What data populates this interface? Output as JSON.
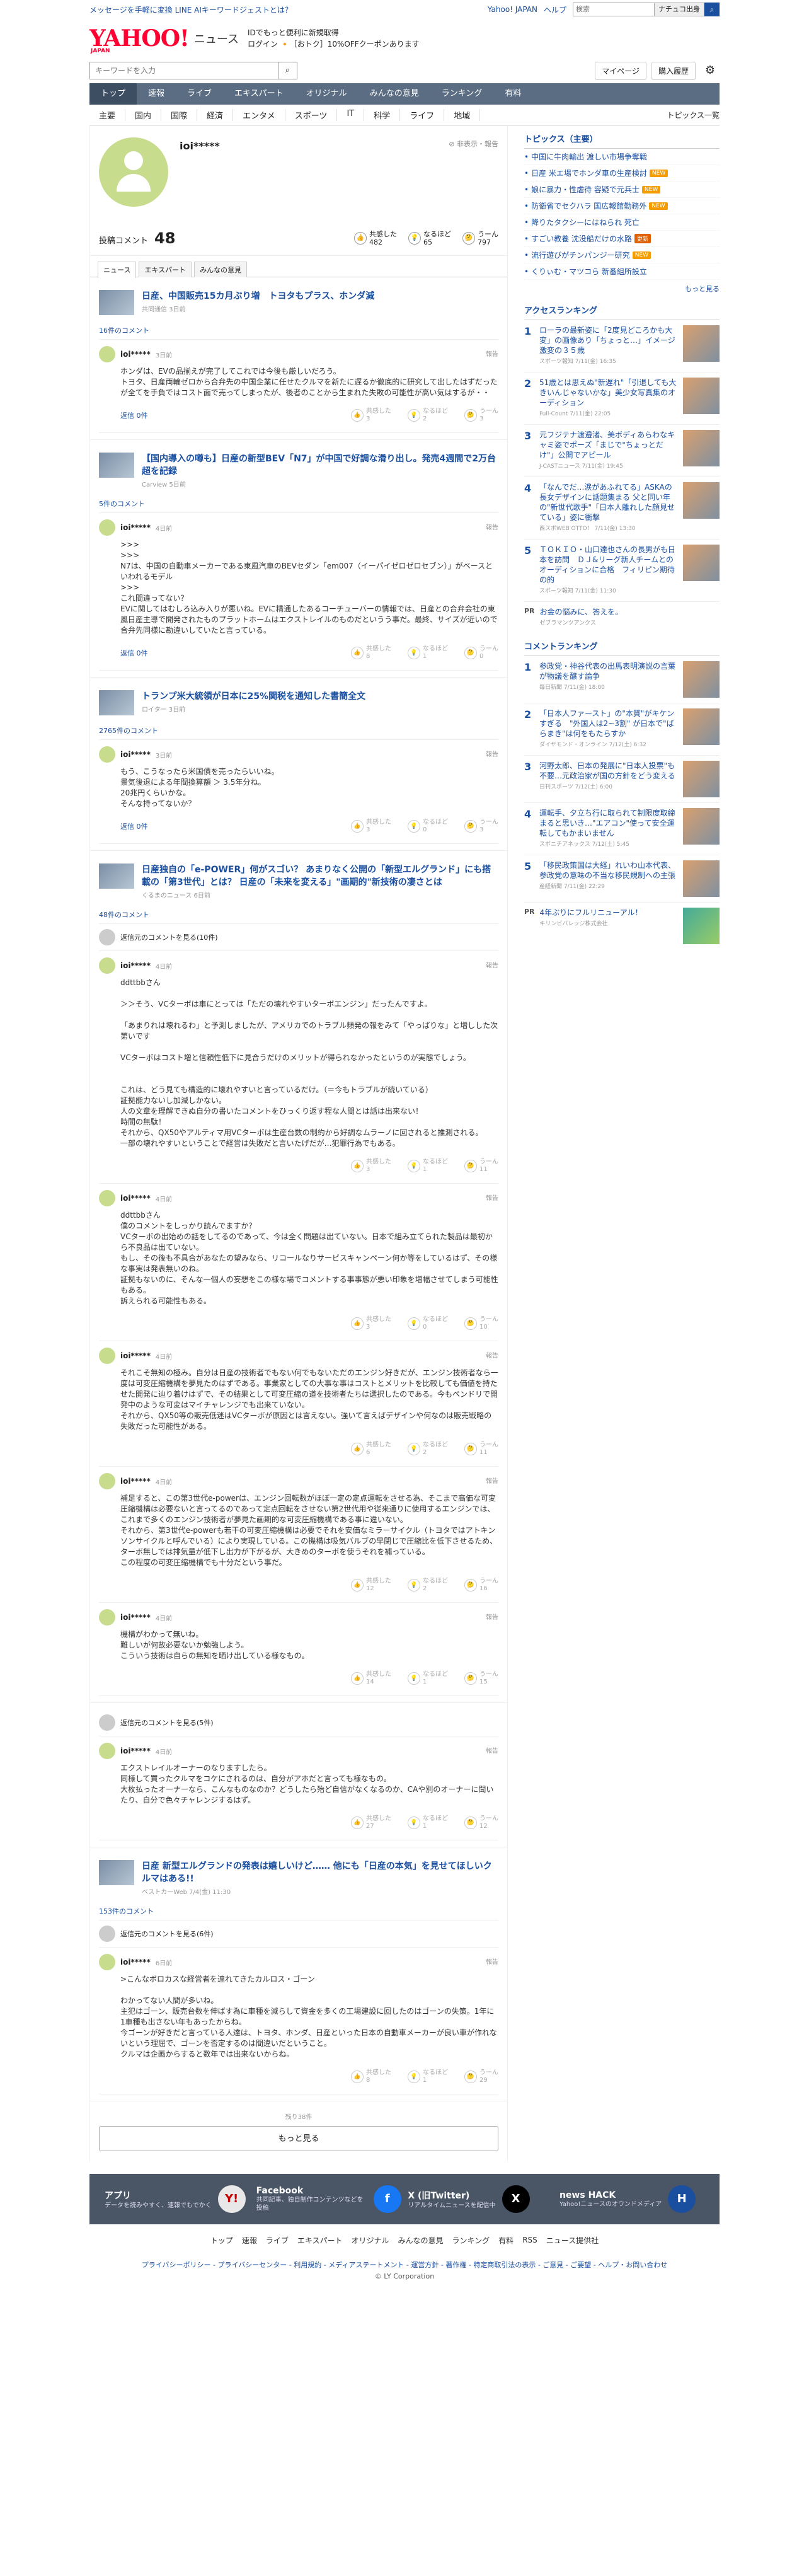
{
  "topbar": {
    "promo": "メッセージを手軽に変換 LINE AIキーワードジェストとは？",
    "yahoo_link": "Yahoo! JAPAN",
    "help": "ヘルプ",
    "search_placeholder": "検索",
    "search_button": "ナチュコ出身",
    "search_icon": "search-icon"
  },
  "header": {
    "logo": "YAHOO!",
    "logo_sub": "JAPAN",
    "logo_news": "ニュース",
    "promo_line1": "IDでもっと便利に新規取得",
    "promo_line2": "ログイン 🔸［おトク］10%OFFクーポンあります"
  },
  "searchrow": {
    "placeholder": "キーワードを入力",
    "mypage": "マイページ",
    "shopping": "購入履歴"
  },
  "nav1": [
    "トップ",
    "速報",
    "ライブ",
    "エキスパート",
    "オリジナル",
    "みんなの意見",
    "ランキング",
    "有料"
  ],
  "nav2": {
    "items": [
      "主要",
      "国内",
      "国際",
      "経済",
      "エンタメ",
      "スポーツ",
      "IT",
      "科学",
      "ライフ",
      "地域"
    ],
    "right": "トピックス一覧"
  },
  "profile": {
    "name": "ioi*****",
    "caution": "⊘ 非表示・報告"
  },
  "stats": {
    "label": "投稿コメント",
    "count": "48",
    "r1_label": "共感した",
    "r1": "482",
    "r2_label": "なるほど",
    "r2": "65",
    "r3_label": "うーん",
    "r3": "797"
  },
  "tabs": [
    "ニュース",
    "エキスパート",
    "みんなの意見"
  ],
  "blocks": [
    {
      "title": "日産、中国販売15カ月ぶり増　トヨタもプラス、ホンダ減",
      "meta": "共同通信 3日前",
      "count": "16件のコメント",
      "hidden": "",
      "comments": [
        {
          "name": "ioi*****",
          "date": "3日前",
          "body": "ホンダは、EVの品揃えが完了してこれでは今後も厳しいだろう。\nトヨタ、日産両輪ゼロから合弁先の中国企業に任せたクルマを新たに遅るか徹底的に研究して出したはずだったが全てを手負ではコスト面で売ってしまったが、後者のことから生まれた失敗の可能性が高い気はするが・・",
          "reply": "返信 0件",
          "a": "3",
          "b": "2",
          "c": "3"
        }
      ]
    },
    {
      "title": "【国内導入の噂も】日産の新型BEV「N7」が中国で好調な滑り出し。発売4週間で2万台超を記録",
      "meta": "Carview 5日前",
      "count": "5件のコメント",
      "hidden": "",
      "comments": [
        {
          "name": "ioi*****",
          "date": "4日前",
          "body": ">>>\n>>>\nN7は、中国の自動車メーカーである東風汽車のBEVセダン「em007（イーパイゼロゼロセブン）」がベースといわれるモデル\n>>>\nこれ間違ってない？\nEVに関してはむしろ込み入りが悪いね。EVに精通したあるコーチューバーの情報では、日産との合弁会社の東風日産主導で開発されたものプラットホームはエクストレイルのものだというう事だ。最終、サイズが近いので合弁先同様に勘違いしていたと言っている。",
          "reply": "返信 0件",
          "a": "8",
          "b": "1",
          "c": "0"
        }
      ]
    },
    {
      "title": "トランプ米大統領が日本に25%関税を通知した書簡全文",
      "meta": "ロイター 3日前",
      "count": "2765件のコメント",
      "hidden": "",
      "comments": [
        {
          "name": "ioi*****",
          "date": "3日前",
          "body": "もう、こうなったら米国債を売ったらいいね。\n景気後退による年間換算額 ＞ 3.5年分ね。\n20兆円くらいかな。\nそんな持ってないか？",
          "reply": "返信 0件",
          "a": "3",
          "b": "0",
          "c": "3"
        }
      ]
    },
    {
      "title": "日産独自の「e-POWER」何がスゴい？ あまりなく公開の「新型エルグランド」にも搭載の「第3世代」とは？ 日産の「未来を変える」\"画期的\"新技術の凄さとは",
      "meta": "くるまのニュース 6日前",
      "count": "48件のコメント",
      "hidden": "返信元のコメントを見る(10件)",
      "comments": [
        {
          "name": "ioi*****",
          "date": "4日前",
          "body": "ddttbbさん\n\n＞＞そう、VCターボは車にとっては「ただの壊れやすいターボエンジン」だったんですよ。\n\n「あまりれは壊れるわ」と予測しましたが、アメリカでのトラブル頻発の報をみて「やっぱりな」と増しした次第いです\n\nVCターボはコスト増と信頼性低下に見合うだけのメリットが得られなかったというのが実態でしょう。\n\n\nこれは、どう見ても構造的に壊れやすいと言っているだけ。（＝今もトラブルが続いている）\n証拠能力ないし加減しかない。\n人の文章を理解できぬ自分の書いたコメントをひっくり返す程な人間とは話は出来ない！\n時間の無駄！\nそれから、QX50やアルティマ用VCターボは生産台数の制約から好調なムラーノに回されると推測される。\n一部の壊れやすいということで経営は失敗だと言いたげだが…犯罪行為でもある。",
          "reply": "",
          "a": "3",
          "b": "1",
          "c": "11"
        },
        {
          "name": "ioi*****",
          "date": "4日前",
          "body": "ddttbbさん\n僕のコメントをしっかり読んでますか？\nVCターボの出始めの話をしてるのであって、今は全く問題は出ていない。日本で組み立てられた製品は最初から不良品は出ていない。\nもし、その後も不具合があなたの望みなら、リコールなりサービスキャンペーン何か等をしているはず、その様な事実は発表無いのね。\n証拠もないのに、そんな一個人の妄想をこの様な場でコメントする事事態が悪い印象を増幅させてしまう可能性もある。\n訴えられる可能性もある。",
          "reply": "",
          "a": "3",
          "b": "0",
          "c": "10"
        },
        {
          "name": "ioi*****",
          "date": "4日前",
          "body": "それこそ無知の極み。自分は日産の技術者でもない何でもないただのエンジン好きだが、エンジン技術者なら一度は可変圧縮機構を夢見たのはずである。事業家としての大事な事はコストとメリットを比較しても価値を持たせた開発に辿り着けはずで、その結果として可変圧縮の道を技術者たちは選択したのである。今もペンドリで開発中のような可変はマイチャレンジでも出来ていない。\nそれから、QX50等の販売低迷はVCターボが原因とは言えない。強いて言えばデザインや何なのは販売戦略の失敗だった可能性がある。",
          "reply": "",
          "a": "6",
          "b": "2",
          "c": "11"
        },
        {
          "name": "ioi*****",
          "date": "4日前",
          "body": "補足すると、この第3世代e-powerは、エンジン回転数がほぼ一定の定点運転をさせる為、そこまで高価な可変圧縮機構は必要ないと言ってるのであって定点回転をさせない第2世代用や従来通りに使用するエンジンでは、これまで多くのエンジン技術者が夢見た画期的な可変圧縮機構である事に違いない。\nそれから、第3世代e-powerも若干の可変圧縮機構は必要でそれを安価なミラーサイクル（トヨタではアトキンソンサイクルと呼んでいる）により実現している。この機構は吸気バルブの早閉じで圧縮比を低下させるため、ターボ無しでは排気量が低下し出力が下がるが、大きめのターボを使うそれを補っている。\nこの程度の可変圧縮機構でも十分だという事だ。",
          "reply": "",
          "a": "12",
          "b": "2",
          "c": "16"
        },
        {
          "name": "ioi*****",
          "date": "4日前",
          "body": "機構がわかって無いね。\n難しいが何故必要ないか勉強しよう。\nこういう技術は自らの無知を晒け出している様なもの。",
          "reply": "",
          "a": "14",
          "b": "1",
          "c": "15"
        }
      ]
    },
    {
      "title": "",
      "meta": "",
      "count": "",
      "hidden": "返信元のコメントを見る(5件)",
      "comments": [
        {
          "name": "ioi*****",
          "date": "4日前",
          "body": "エクストレイルオーナーのなりますしたら。\n同様して買ったクルマをコケにされるのは、自分がアホだと言っても様なもの。\n大枚払ったオーナーなら、こんなものなのか？どうしたら殆ど自信がなくなるのか、CAや別のオーナーに聞いたり、自分で色々チャレンジするはず。",
          "reply": "",
          "a": "27",
          "b": "1",
          "c": "12"
        }
      ]
    },
    {
      "title": "日産 新型エルグランドの発表は嬉しいけど……  他にも「日産の本気」を見せてほしいクルマはある!!",
      "meta": "ベストカーWeb 7/4(金) 11:30",
      "count": "153件のコメント",
      "hidden": "返信元のコメントを見る(6件)",
      "comments": [
        {
          "name": "ioi*****",
          "date": "6日前",
          "body": ">こんなボロカスな経営者を連れてきたカルロス・ゴーン\n\nわかってない人間が多いね。\n主犯はゴーン、販売台数を伸ばす為に車種を減らして資金を多くの工場建設に回したのはゴーンの失策。1年に1車種も出さない年もあったからね。\n今ゴーンが好きだと言っている人達は、トヨタ、ホンダ、日産といった日本の自動車メーカーが良い車が作れないという理屈で、ゴーンを否定するのは間違いだということ。\nクルマは企画からすると数年では出来ないからね。",
          "reply": "",
          "a": "8",
          "b": "1",
          "c": "29"
        }
      ]
    }
  ],
  "more": {
    "remaining": "残り38件",
    "button": "もっと見る"
  },
  "side": {
    "topics_title": "トピックス（主要）",
    "topics": [
      {
        "t": "中国に牛肉輸出 渡しい市場争奪戦",
        "b": ""
      },
      {
        "t": "日産 米エ場でホンダ車の生産検討",
        "b": "new"
      },
      {
        "t": "娘に暴力・性虐待 容疑で元兵士",
        "b": "new"
      },
      {
        "t": "防衛省でセクハラ 国広報館勤務外",
        "b": "new"
      },
      {
        "t": "降りたタクシーにはねられ 死亡",
        "b": ""
      },
      {
        "t": "すごい教養 沈没船だけの水路",
        "b": "upd"
      },
      {
        "t": "流行遊びがチンパンジー研究",
        "b": "new"
      },
      {
        "t": "くりぃむ・マツコら 新番組所設立",
        "b": ""
      }
    ],
    "topics_more": "もっと見る",
    "access_title": "アクセスランキング",
    "access": [
      {
        "t": "ローラの最新姿に「2度見どころかも大変」の画像あり「ちょっと…」イメージ激変の３５歳",
        "m": "スポーツ報知 7/11(金) 16:35"
      },
      {
        "t": "51歳とは思えぬ\"新遅れ\"「引退しても大きいんじゃないかな」美少女写真集のオーディション",
        "m": "Full-Count 7/11(金) 22:05"
      },
      {
        "t": "元フジテナ渡邉渚、美ボディあらわなキャミ姿でポーズ「まじで\"ちょっとだけ\"」公開でアピール",
        "m": "J-CASTニュース 7/11(金) 19:45"
      },
      {
        "t": "「なんでだ…涙があふれてる」ASKAの長女デザインに話題集まる 父と同い年の\"新世代歌手\"「日本人離れした顔見せている」姿に衝撃",
        "m": "西スポWEB OTTO！ 7/11(金) 13:30"
      },
      {
        "t": "ＴＯＫＩＯ・山口達也さんの長男がも日本を訪問　ＤＪ&リーグ新人チームとのオーディションに合格　フィリピン期待の的",
        "m": "スポーツ報知 7/11(金) 11:30"
      }
    ],
    "access_pr": {
      "label": "PR",
      "t": "お金の悩みに、答えを。",
      "m": "ゼブラマンツアンクス"
    },
    "comment_title": "コメントランキング",
    "commentrank": [
      {
        "t": "参政党・神谷代表の出馬表明演説の言葉が物議を醸す論争",
        "m": "毎日新聞 7/11(金) 18:00"
      },
      {
        "t": "「日本人ファースト」の\"本質\"がキケンすぎる　\"外国人は2~3割\" が日本で\"ばらまき\"は何をもたらすか",
        "m": "ダイヤモンド・オンライン 7/12(土) 6:32"
      },
      {
        "t": "河野太郎、日本の発展に\"日本人投票\"も不要…元政治家が国の方針をどう変える",
        "m": "日刊スポーツ 7/12(土) 6:00"
      },
      {
        "t": "運転手、夕立ち行に取られて制限度取締まると思いき…\"エアコン\"使って安全運転してもかまいません",
        "m": "スポニチアネックス 7/12(土) 5:45"
      },
      {
        "t": "「移民政策国は大経」れいわ山本代表、参政党の意味の不当な移民規制への主張",
        "m": "産経新聞 7/11(金) 22:29"
      }
    ],
    "comment_pr": {
      "label": "PR",
      "t": "4年ぶりにフルリニューアル！",
      "m": "キリンビバレッジ株式会社"
    }
  },
  "footer": {
    "apps": [
      {
        "t": "アプリ",
        "d": "データを読みやすく、速報でもでかく",
        "icon": "app-icon"
      },
      {
        "t": "Facebook",
        "d": "共同記事、独自制作コンテンツなどを投稿",
        "icon": "facebook-icon"
      },
      {
        "t": "X (旧Twitter)",
        "d": "リアルタイムニュースを配信中",
        "icon": "x-icon"
      },
      {
        "t": "news HACK",
        "d": "Yahoo!ニュースのオウンドメディア",
        "icon": "newshack-icon"
      }
    ],
    "links": [
      "トップ",
      "速報",
      "ライブ",
      "エキスパート",
      "オリジナル",
      "みんなの意見",
      "ランキング",
      "有料",
      "RSS",
      "ニュース提供社"
    ],
    "bottom_links": "プライバシーポリシー - プライバシーセンター - 利用規約 - メディアステートメント - 運営方針 - 著作権 - 特定商取引法の表示 - ご意見 - ご要望 - ヘルプ・お問い合わせ",
    "copyright": "© LY Corporation"
  }
}
